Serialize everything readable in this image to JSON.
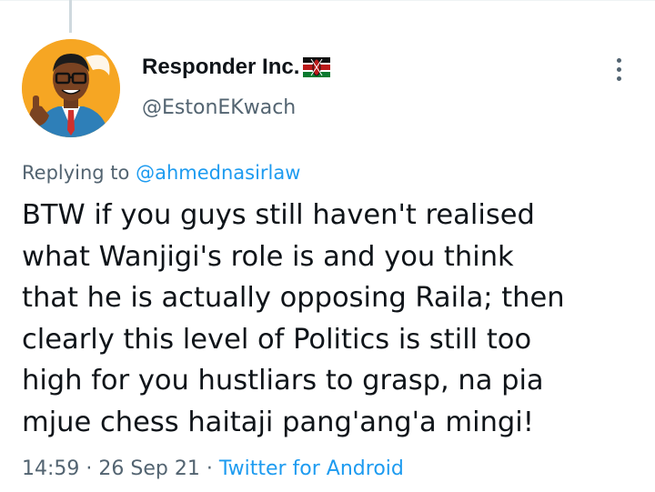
{
  "author": {
    "display_name": "Responder Inc.",
    "handle": "@EstonEKwach",
    "flag_emoji": "kenya-flag-icon"
  },
  "reply": {
    "prefix": "Replying to",
    "to_handle": "@ahmednasirlaw"
  },
  "tweet": {
    "lines": [
      "BTW if you guys still haven't realised",
      "what Wanjigi's role is and you think",
      "that he is actually opposing Raila; then",
      "clearly this level of Politics is still too",
      "high for you hustliars to grasp, na pia",
      "mjue chess haitaji pang'ang'a mingi!"
    ]
  },
  "meta": {
    "time": "14:59",
    "separator": " · ",
    "date": "26 Sep 21",
    "source": "Twitter for Android"
  },
  "colors": {
    "link": "#1d9bf0",
    "muted": "#536471",
    "text": "#0f1419"
  }
}
